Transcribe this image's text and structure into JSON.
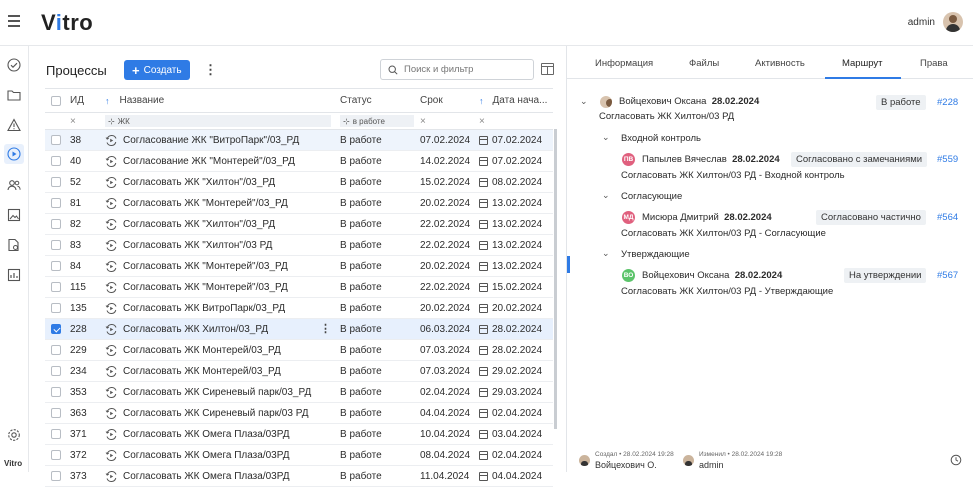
{
  "app": {
    "logo_prefix": "V",
    "logo_accent": "i",
    "logo_suffix": "tro",
    "brand_small": "Vitro",
    "user_name": "admin"
  },
  "colors": {
    "accent": "#2f7be5"
  },
  "rail_icons": [
    "check-circle-icon",
    "folder-icon",
    "warning-icon",
    "play-icon",
    "users-icon",
    "image-icon",
    "document-settings-icon",
    "chart-icon",
    "settings-icon"
  ],
  "left": {
    "title": "Процессы",
    "create_label": "Создать",
    "search_placeholder": "Поиск и фильтр",
    "columns": {
      "id": "ИД",
      "name": "Название",
      "status": "Статус",
      "due": "Срок",
      "start": "Дата нача..."
    },
    "filters": {
      "name": "ЖК",
      "status": "в работе"
    },
    "rows": [
      {
        "id": "38",
        "name": "Согласование ЖК \"ВитроПарк\"/03_РД",
        "status": "В работе",
        "due": "07.02.2024",
        "start": "07.02.2024"
      },
      {
        "id": "40",
        "name": "Согласование ЖК \"Монтерей\"/03_РД",
        "status": "В работе",
        "due": "14.02.2024",
        "start": "07.02.2024"
      },
      {
        "id": "52",
        "name": "Согласовать ЖК \"Хилтон\"/03_РД",
        "status": "В работе",
        "due": "15.02.2024",
        "start": "08.02.2024"
      },
      {
        "id": "81",
        "name": "Согласовать ЖК \"Монтерей\"/03_РД",
        "status": "В работе",
        "due": "20.02.2024",
        "start": "13.02.2024"
      },
      {
        "id": "82",
        "name": "Согласовать ЖК \"Хилтон\"/03_РД",
        "status": "В работе",
        "due": "22.02.2024",
        "start": "13.02.2024"
      },
      {
        "id": "83",
        "name": "Согласовать ЖК \"Хилтон\"/03 РД",
        "status": "В работе",
        "due": "22.02.2024",
        "start": "13.02.2024"
      },
      {
        "id": "84",
        "name": "Согласовать ЖК \"Монтерей\"/03_РД",
        "status": "В работе",
        "due": "20.02.2024",
        "start": "13.02.2024"
      },
      {
        "id": "115",
        "name": "Согласовать ЖК \"Монтерей\"/03_РД",
        "status": "В работе",
        "due": "22.02.2024",
        "start": "15.02.2024"
      },
      {
        "id": "135",
        "name": "Согласовать ЖК ВитроПарк/03_РД",
        "status": "В работе",
        "due": "20.02.2024",
        "start": "20.02.2024"
      },
      {
        "id": "228",
        "name": "Согласовать ЖК Хилтон/03_РД",
        "status": "В работе",
        "due": "06.03.2024",
        "start": "28.02.2024"
      },
      {
        "id": "229",
        "name": "Согласовать ЖК Монтерей/03_РД",
        "status": "В работе",
        "due": "07.03.2024",
        "start": "28.02.2024"
      },
      {
        "id": "234",
        "name": "Согласовать ЖК Монтерей/03_РД",
        "status": "В работе",
        "due": "07.03.2024",
        "start": "29.02.2024"
      },
      {
        "id": "353",
        "name": "Согласовать ЖК Сиреневый парк/03_РД",
        "status": "В работе",
        "due": "02.04.2024",
        "start": "29.03.2024"
      },
      {
        "id": "363",
        "name": "Согласовать ЖК Сиреневый парк/03 РД",
        "status": "В работе",
        "due": "04.04.2024",
        "start": "02.04.2024"
      },
      {
        "id": "371",
        "name": "Согласовать ЖК Омега Плаза/03РД",
        "status": "В работе",
        "due": "10.04.2024",
        "start": "03.04.2024"
      },
      {
        "id": "372",
        "name": "Согласовать ЖК Омега Плаза/03РД",
        "status": "В работе",
        "due": "08.04.2024",
        "start": "02.04.2024"
      },
      {
        "id": "373",
        "name": "Согласовать ЖК Омега Плаза/03РД",
        "status": "В работе",
        "due": "11.04.2024",
        "start": "04.04.2024"
      }
    ]
  },
  "right": {
    "tabs": [
      "Информация",
      "Файлы",
      "Активность",
      "Маршрут",
      "Права"
    ],
    "active_tab": "Маршрут",
    "root": {
      "person": "Войцехович Оксана",
      "date": "28.02.2024",
      "status": "В работе",
      "link": "#228",
      "desc": "Согласовать ЖК Хилтон/03 РД"
    },
    "stages": [
      {
        "name": "Входной контроль",
        "initials": "ПВ",
        "avatar_color": "#e0607e",
        "person": "Папылев Вячеслав",
        "date": "28.02.2024",
        "status": "Согласовано с замечаниями",
        "link": "#559",
        "desc": "Согласовать ЖК Хилтон/03 РД - Входной контроль"
      },
      {
        "name": "Согласующие",
        "initials": "МД",
        "avatar_color": "#e0607e",
        "person": "Мисюра Дмитрий",
        "date": "28.02.2024",
        "status": "Согласовано частично",
        "link": "#564",
        "desc": "Согласовать ЖК Хилтон/03 РД - Согласующие"
      },
      {
        "name": "Утверждающие",
        "initials": "ВО",
        "avatar_color": "#5cc46b",
        "person": "Войцехович Оксана",
        "date": "28.02.2024",
        "status": "На утверждении",
        "link": "#567",
        "desc": "Согласовать ЖК Хилтон/03 РД - Утверждающие"
      }
    ],
    "footer": {
      "created_meta": "Создал • 28.02.2024 19:28",
      "created_by": "Войцехович О.",
      "changed_meta": "Изменил • 28.02.2024 19:28",
      "changed_by": "admin"
    }
  }
}
